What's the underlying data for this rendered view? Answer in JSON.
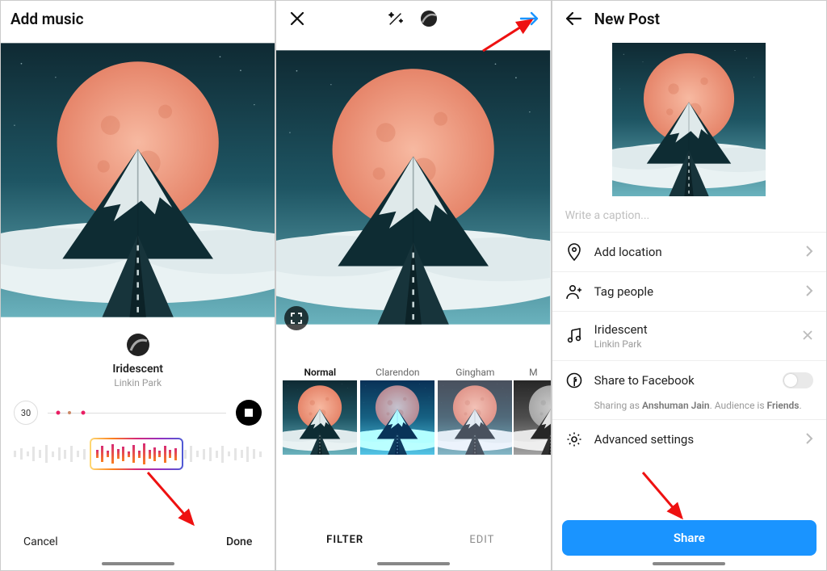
{
  "panel1": {
    "title": "Add music",
    "song_title": "Iridescent",
    "song_artist": "Linkin Park",
    "duration_chip": "30",
    "cancel": "Cancel",
    "done": "Done"
  },
  "panel2": {
    "filters": [
      {
        "label": "Normal",
        "tint": "none"
      },
      {
        "label": "Clarendon",
        "tint": "clarendon"
      },
      {
        "label": "Gingham",
        "tint": "gingham"
      },
      {
        "label": "M",
        "tint": "moon"
      }
    ],
    "tab_filter": "FILTER",
    "tab_edit": "EDIT"
  },
  "panel3": {
    "title": "New Post",
    "caption_placeholder": "Write a caption...",
    "row_location": "Add location",
    "row_tag": "Tag people",
    "song_title": "Iridescent",
    "song_artist": "Linkin Park",
    "row_fb": "Share to Facebook",
    "share_note_pre": "Sharing as ",
    "share_note_name": "Anshuman Jain",
    "share_note_mid": ". Audience is ",
    "share_note_aud": "Friends",
    "share_note_suf": ".",
    "row_adv": "Advanced settings",
    "share": "Share"
  }
}
